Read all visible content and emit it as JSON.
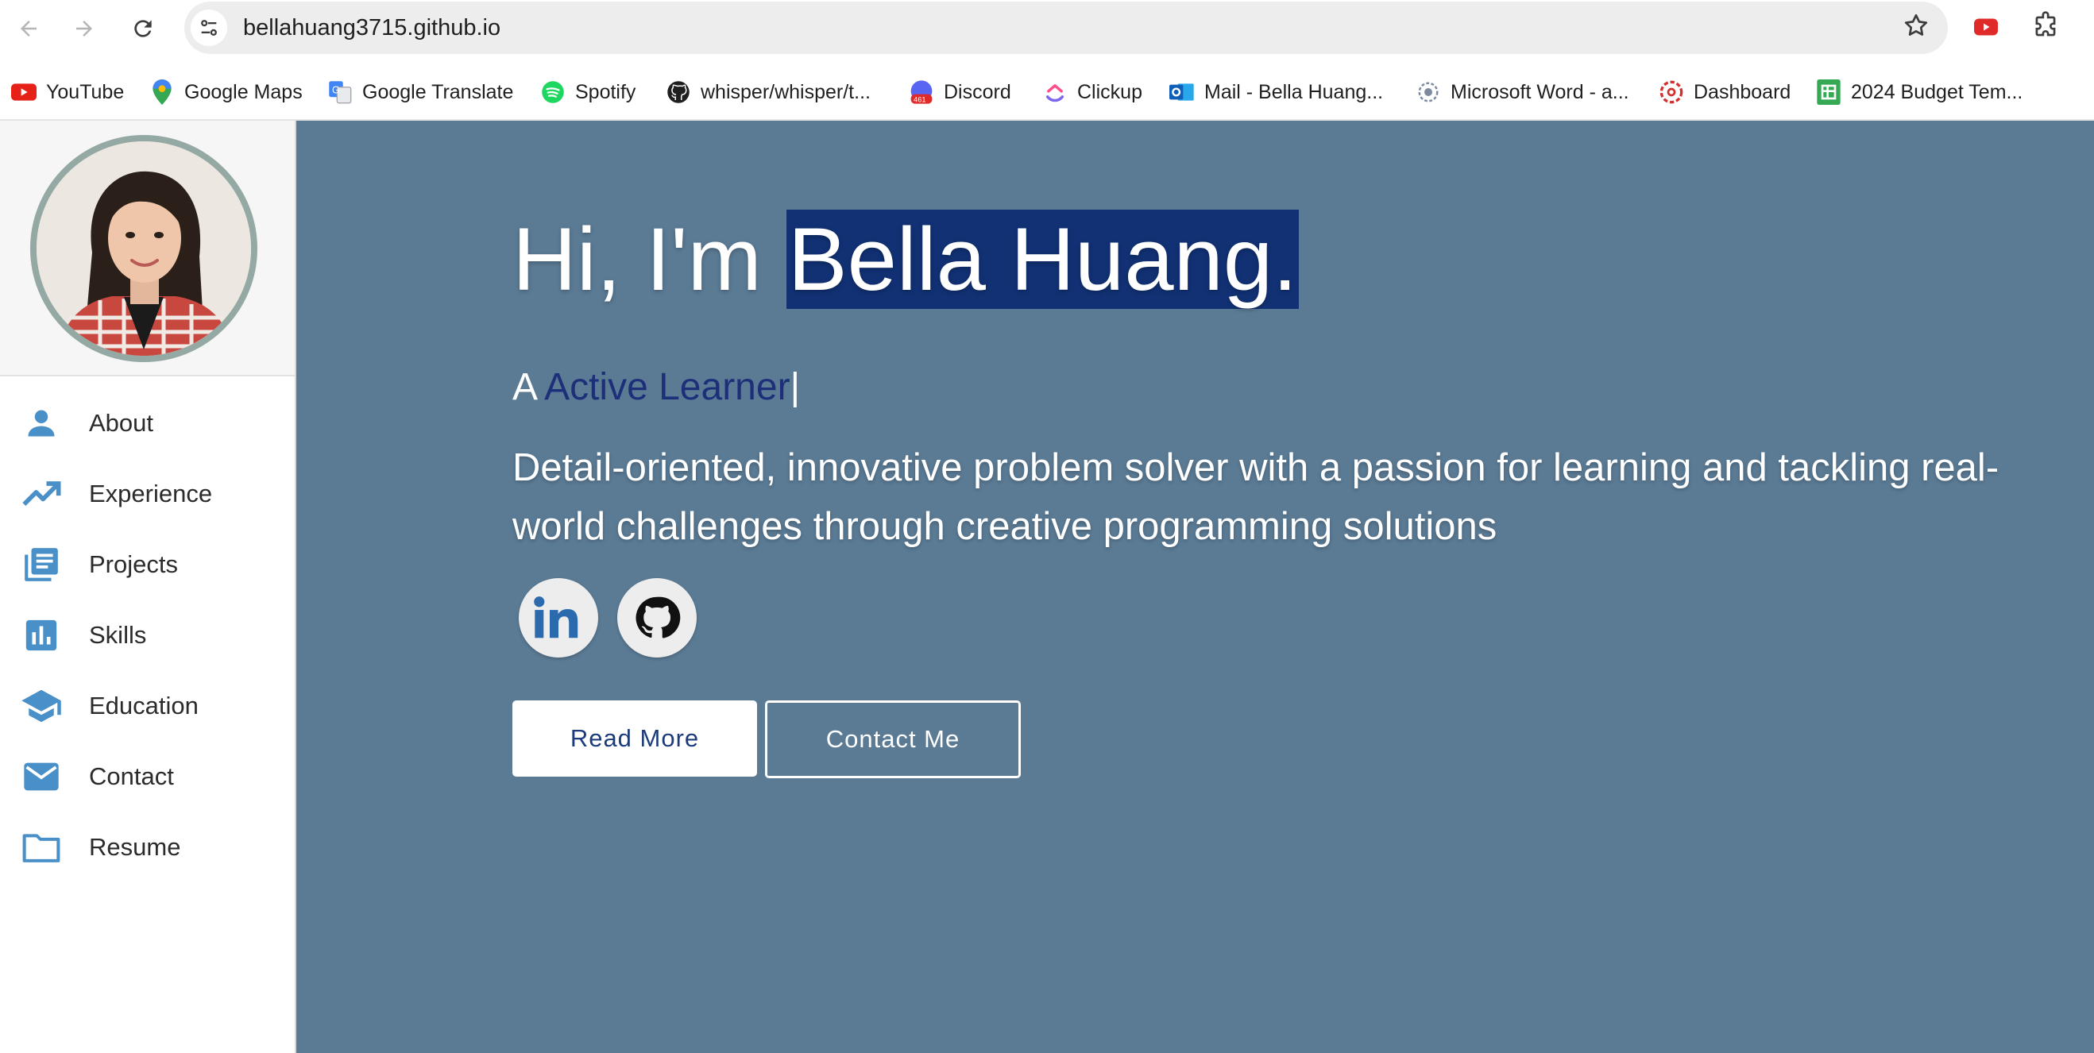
{
  "browser": {
    "url": "bellahuang3715.github.io",
    "bookmarks": [
      {
        "label": "YouTube",
        "icon": "youtube-icon"
      },
      {
        "label": "Google Maps",
        "icon": "google-maps-icon"
      },
      {
        "label": "Google Translate",
        "icon": "google-translate-icon"
      },
      {
        "label": "Spotify",
        "icon": "spotify-icon"
      },
      {
        "label": "whisper/whisper/t...",
        "icon": "github-icon"
      },
      {
        "label": "Discord",
        "icon": "discord-icon",
        "badge": "461"
      },
      {
        "label": "Clickup",
        "icon": "clickup-icon"
      },
      {
        "label": "Mail - Bella Huang...",
        "icon": "outlook-icon"
      },
      {
        "label": "Microsoft Word - a...",
        "icon": "word-doc-icon"
      },
      {
        "label": "Dashboard",
        "icon": "dashboard-icon"
      },
      {
        "label": "2024 Budget Tem...",
        "icon": "sheets-icon"
      }
    ]
  },
  "sidebar": {
    "items": [
      {
        "label": "About",
        "icon": "person-icon"
      },
      {
        "label": "Experience",
        "icon": "trending-up-icon"
      },
      {
        "label": "Projects",
        "icon": "library-books-icon"
      },
      {
        "label": "Skills",
        "icon": "bar-chart-icon"
      },
      {
        "label": "Education",
        "icon": "school-icon"
      },
      {
        "label": "Contact",
        "icon": "mail-icon"
      },
      {
        "label": "Resume",
        "icon": "folder-icon"
      }
    ]
  },
  "hero": {
    "greeting": "Hi, I'm ",
    "name": "Bella Huang.",
    "role_prefix": "A ",
    "role_typed": "Active Learner",
    "cursor": "|",
    "description": "Detail-oriented, innovative problem solver with a passion for learning and tackling real-world challenges through creative programming solutions",
    "read_more": "Read More",
    "contact_me": "Contact Me"
  },
  "colors": {
    "hero_bg": "#5b7b95",
    "highlight": "#113174",
    "nav_icon": "#4a90c8",
    "role_text": "#1e2f7a"
  }
}
